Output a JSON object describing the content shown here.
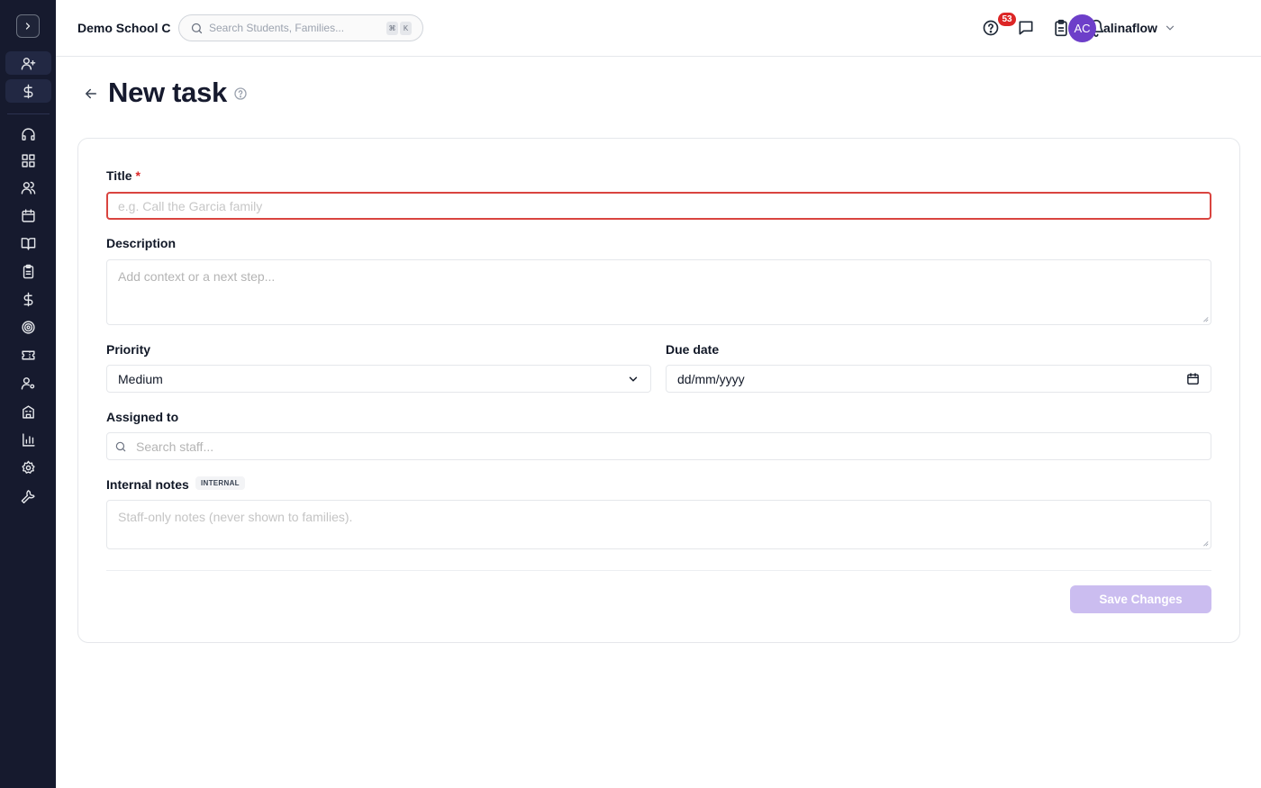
{
  "header": {
    "school_name": "Demo School C",
    "search_placeholder": "Search Students, Families...",
    "shortcut_keys": [
      "⌘",
      "K"
    ],
    "tasks_badge_count": "53",
    "user_initials": "AC",
    "username": "alinaflow"
  },
  "sidebar": {
    "items": [
      {
        "icon": "user-plus-icon"
      },
      {
        "icon": "dollar-icon"
      },
      {
        "icon": "headset-icon"
      },
      {
        "icon": "dashboard-icon"
      },
      {
        "icon": "users-icon"
      },
      {
        "icon": "calendar-icon"
      },
      {
        "icon": "book-icon"
      },
      {
        "icon": "clipboard-icon"
      },
      {
        "icon": "dollar-icon"
      },
      {
        "icon": "target-icon"
      },
      {
        "icon": "ticket-icon"
      },
      {
        "icon": "user-settings-icon"
      },
      {
        "icon": "building-icon"
      },
      {
        "icon": "bar-chart-icon"
      },
      {
        "icon": "gear-icon"
      },
      {
        "icon": "wrench-icon"
      }
    ]
  },
  "page": {
    "title": "New task"
  },
  "form": {
    "title_label": "Title",
    "title_required_mark": "*",
    "title_placeholder": "e.g. Call the Garcia family",
    "description_label": "Description",
    "description_placeholder": "Add context or a next step...",
    "priority_label": "Priority",
    "priority_value": "Medium",
    "due_date_label": "Due date",
    "due_date_placeholder": "dd/mm/yyyy",
    "assigned_label": "Assigned to",
    "assigned_placeholder": "Search staff...",
    "notes_label": "Internal notes",
    "notes_tag": "INTERNAL",
    "notes_placeholder": "Staff-only notes (never shown to families).",
    "save_label": "Save Changes"
  },
  "colors": {
    "sidebar_bg": "#161a2e",
    "accent": "#6d3fc9",
    "error_border": "#d9443f",
    "save_disabled": "#cbbdf0"
  }
}
